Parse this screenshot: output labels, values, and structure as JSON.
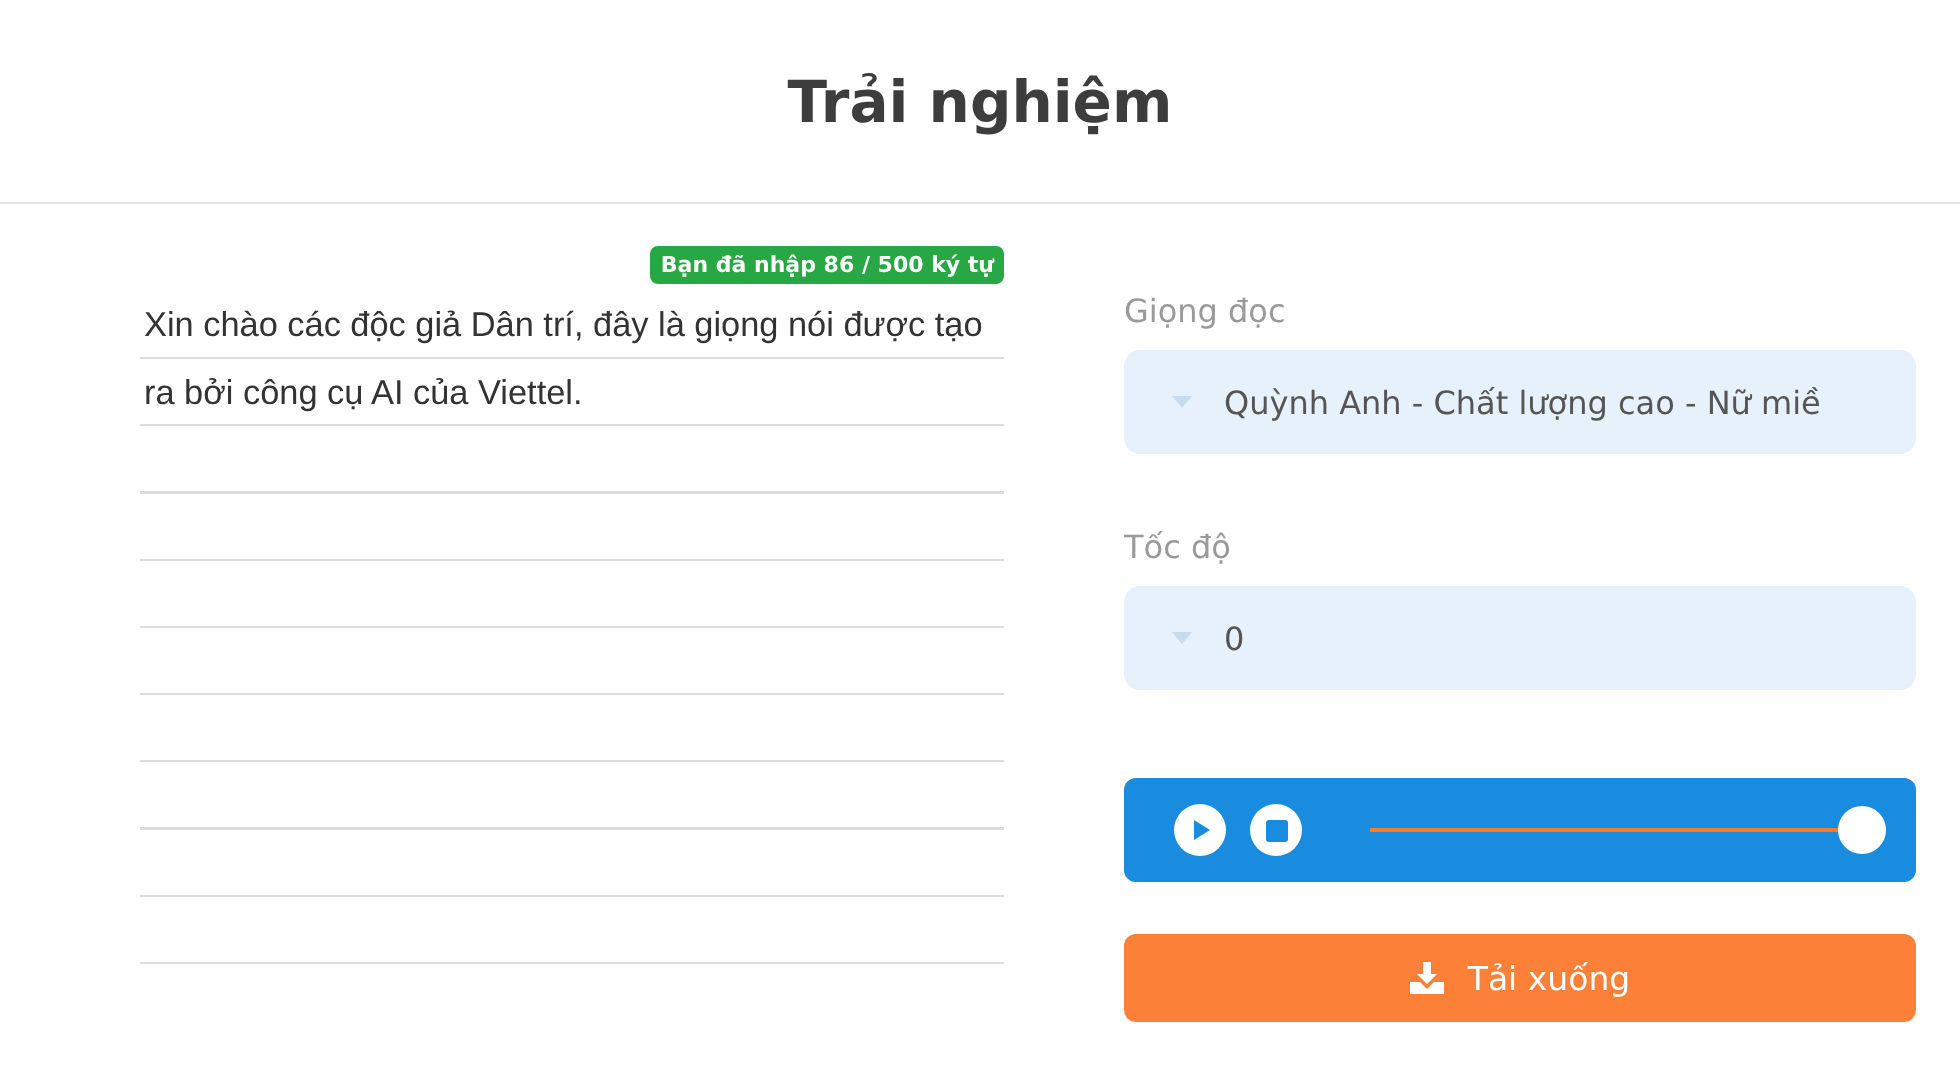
{
  "title": "Trải nghiệm",
  "editor": {
    "counter": "Bạn đã nhập 86 / 500 ký tự",
    "text": "Xin chào các độc giả Dân trí, đây là giọng nói được tạo ra bởi công cụ AI của Viettel."
  },
  "voice": {
    "label": "Giọng đọc",
    "value": "Quỳnh Anh - Chất lượng cao - Nữ miề"
  },
  "speed": {
    "label": "Tốc độ",
    "value": "0"
  },
  "player": {
    "level": 1
  },
  "download": {
    "label": "Tải xuống"
  }
}
